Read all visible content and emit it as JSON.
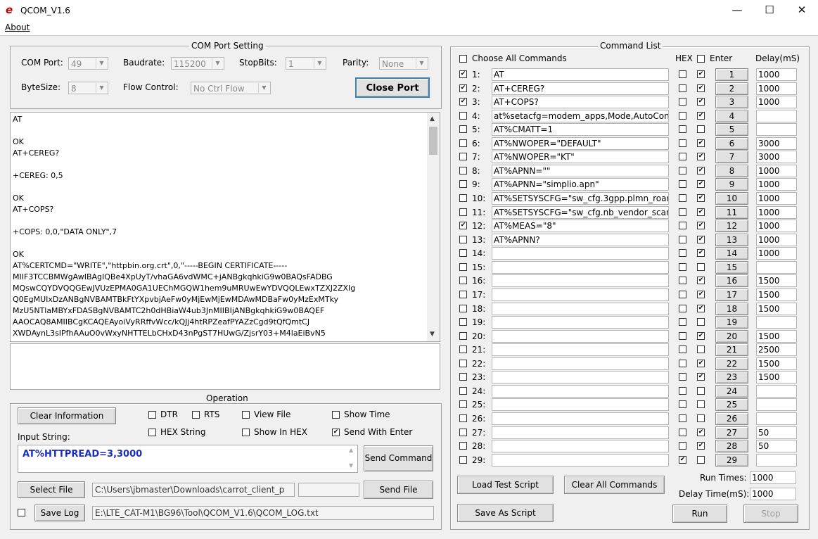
{
  "window": {
    "title": "QCOM_V1.6",
    "minimize": "—",
    "maximize": "☐",
    "close": "✕"
  },
  "menu": {
    "about": "About"
  },
  "com_port_setting": {
    "title": "COM Port Setting",
    "com_port_label": "COM Port:",
    "com_port_value": "49",
    "baudrate_label": "Baudrate:",
    "baudrate_value": "115200",
    "stopbits_label": "StopBits:",
    "stopbits_value": "1",
    "parity_label": "Parity:",
    "parity_value": "None",
    "bytesize_label": "ByteSize:",
    "bytesize_value": "8",
    "flow_label": "Flow Control:",
    "flow_value": "No Ctrl Flow",
    "close_port": "Close Port"
  },
  "log": [
    "AT",
    "",
    "OK",
    "AT+CEREG?",
    "",
    "+CEREG: 0,5",
    "",
    "OK",
    "AT+COPS?",
    "",
    "+COPS: 0,0,\"DATA ONLY\",7",
    "",
    "OK",
    "AT%CERTCMD=\"WRITE\",\"httpbin.org.crt\",0,\"-----BEGIN CERTIFICATE-----",
    "MIIF3TCCBMWgAwIBAgIQBe4XpUyT/vhaGA6vdWMC+jANBgkqhkiG9w0BAQsFADBG",
    "MQswCQYDVQQGEwJVUzEPMA0GA1UEChMGQW1hem9uMRUwEwYDVQQLEwxTZXJ2ZXIg",
    "Q0EgMUIxDzANBgNVBAMTBkFtYXpvbjAeFw0yMjEwMjEwMDAwMDBaFw0yMzExMTky",
    "MzU5NTlaMBYxFDASBgNVBAMTC2h0dHBiaW4ub3JnMIIBIjANBgkqhkiG9w0BAQEF",
    "AAOCAQ8AMIIBCgKCAQEAyoiVyRRffvWcc/kQJj4htRPZeafPYAZzCgd9tQfQmtCJ",
    "XWDAynL3sIPfhAAuO0vWxyNHTTELbCHxD43nPgST7HUwG/ZjsrY03+M4laEiBvN5"
  ],
  "operation": {
    "title": "Operation",
    "clear_info": "Clear Information",
    "dtr": "DTR",
    "rts": "RTS",
    "view_file": "View File",
    "show_time": "Show Time",
    "hex_string": "HEX String",
    "show_in_hex": "Show In HEX",
    "send_with_enter": "Send With Enter",
    "input_string_label": "Input String:",
    "input_string_value": "AT%HTTPREAD=3,3000",
    "send_command": "Send Command",
    "select_file": "Select File",
    "file_path": "C:\\Users\\jbmaster\\Downloads\\carrot_client_p",
    "send_file": "Send File",
    "save_log": "Save Log",
    "log_path": "E:\\LTE_CAT-M1\\BG96\\Tool\\QCOM_V1.6\\QCOM_LOG.txt"
  },
  "command_list": {
    "title": "Command List",
    "choose_all": "Choose All Commands",
    "hex_label": "HEX",
    "enter_label": "Enter",
    "delay_label": "Delay(mS)",
    "rows": [
      {
        "num": "1:",
        "btn": "1",
        "cmd": "AT",
        "sel": true,
        "hex": false,
        "enter": true,
        "delay": "1000"
      },
      {
        "num": "2:",
        "btn": "2",
        "cmd": "AT+CEREG?",
        "sel": true,
        "hex": false,
        "enter": true,
        "delay": "1000"
      },
      {
        "num": "3:",
        "btn": "3",
        "cmd": "AT+COPS?",
        "sel": true,
        "hex": false,
        "enter": true,
        "delay": "1000"
      },
      {
        "num": "4:",
        "btn": "4",
        "cmd": "at%setacfg=modem_apps,Mode,AutoConne",
        "sel": false,
        "hex": false,
        "enter": true,
        "delay": ""
      },
      {
        "num": "5:",
        "btn": "5",
        "cmd": "AT%CMATT=1",
        "sel": false,
        "hex": false,
        "enter": false,
        "delay": ""
      },
      {
        "num": "6:",
        "btn": "6",
        "cmd": "AT%NWOPER=\"DEFAULT\"",
        "sel": false,
        "hex": false,
        "enter": true,
        "delay": "3000"
      },
      {
        "num": "7:",
        "btn": "7",
        "cmd": "AT%NWOPER=\"KT\"",
        "sel": false,
        "hex": false,
        "enter": true,
        "delay": "3000"
      },
      {
        "num": "8:",
        "btn": "8",
        "cmd": "AT%APNN=\"\"",
        "sel": false,
        "hex": false,
        "enter": true,
        "delay": "1000"
      },
      {
        "num": "9:",
        "btn": "9",
        "cmd": "AT%APNN=\"simplio.apn\"",
        "sel": false,
        "hex": false,
        "enter": true,
        "delay": "1000"
      },
      {
        "num": "10:",
        "btn": "10",
        "cmd": "AT%SETSYSCFG=\"sw_cfg.3gpp.plmn_roam",
        "sel": false,
        "hex": false,
        "enter": true,
        "delay": "1000"
      },
      {
        "num": "11:",
        "btn": "11",
        "cmd": "AT%SETSYSCFG=\"sw_cfg.nb_vendor_scan.",
        "sel": false,
        "hex": false,
        "enter": true,
        "delay": "1000"
      },
      {
        "num": "12:",
        "btn": "12",
        "cmd": "AT%MEAS=\"8\"",
        "sel": true,
        "hex": false,
        "enter": true,
        "delay": "1000"
      },
      {
        "num": "13:",
        "btn": "13",
        "cmd": "AT%APNN?",
        "sel": false,
        "hex": false,
        "enter": true,
        "delay": "1000"
      },
      {
        "num": "14:",
        "btn": "14",
        "cmd": "",
        "sel": false,
        "hex": false,
        "enter": true,
        "delay": "1000"
      },
      {
        "num": "15:",
        "btn": "15",
        "cmd": "",
        "sel": false,
        "hex": false,
        "enter": false,
        "delay": ""
      },
      {
        "num": "16:",
        "btn": "16",
        "cmd": "",
        "sel": false,
        "hex": false,
        "enter": true,
        "delay": "1500"
      },
      {
        "num": "17:",
        "btn": "17",
        "cmd": "",
        "sel": false,
        "hex": false,
        "enter": true,
        "delay": "1500"
      },
      {
        "num": "18:",
        "btn": "18",
        "cmd": "",
        "sel": false,
        "hex": false,
        "enter": true,
        "delay": "1500"
      },
      {
        "num": "19:",
        "btn": "19",
        "cmd": "",
        "sel": false,
        "hex": false,
        "enter": false,
        "delay": ""
      },
      {
        "num": "20:",
        "btn": "20",
        "cmd": "",
        "sel": false,
        "hex": false,
        "enter": true,
        "delay": "1500"
      },
      {
        "num": "21:",
        "btn": "21",
        "cmd": "",
        "sel": false,
        "hex": false,
        "enter": false,
        "delay": "2500"
      },
      {
        "num": "22:",
        "btn": "22",
        "cmd": "",
        "sel": false,
        "hex": false,
        "enter": true,
        "delay": "1500"
      },
      {
        "num": "23:",
        "btn": "23",
        "cmd": "",
        "sel": false,
        "hex": false,
        "enter": true,
        "delay": "1500"
      },
      {
        "num": "24:",
        "btn": "24",
        "cmd": "",
        "sel": false,
        "hex": false,
        "enter": false,
        "delay": ""
      },
      {
        "num": "25:",
        "btn": "25",
        "cmd": "",
        "sel": false,
        "hex": false,
        "enter": false,
        "delay": ""
      },
      {
        "num": "26:",
        "btn": "26",
        "cmd": "",
        "sel": false,
        "hex": false,
        "enter": false,
        "delay": ""
      },
      {
        "num": "27:",
        "btn": "27",
        "cmd": "",
        "sel": false,
        "hex": false,
        "enter": true,
        "delay": "50"
      },
      {
        "num": "28:",
        "btn": "28",
        "cmd": "",
        "sel": false,
        "hex": false,
        "enter": true,
        "delay": "50"
      },
      {
        "num": "29:",
        "btn": "29",
        "cmd": "",
        "sel": false,
        "hex": true,
        "enter": false,
        "delay": ""
      }
    ],
    "load_test_script": "Load Test Script",
    "clear_all_commands": "Clear All Commands",
    "save_as_script": "Save As Script",
    "run_times_label": "Run Times:",
    "run_times_value": "1000",
    "delay_time_label": "Delay Time(mS):",
    "delay_time_value": "1000",
    "run": "Run",
    "stop": "Stop"
  }
}
